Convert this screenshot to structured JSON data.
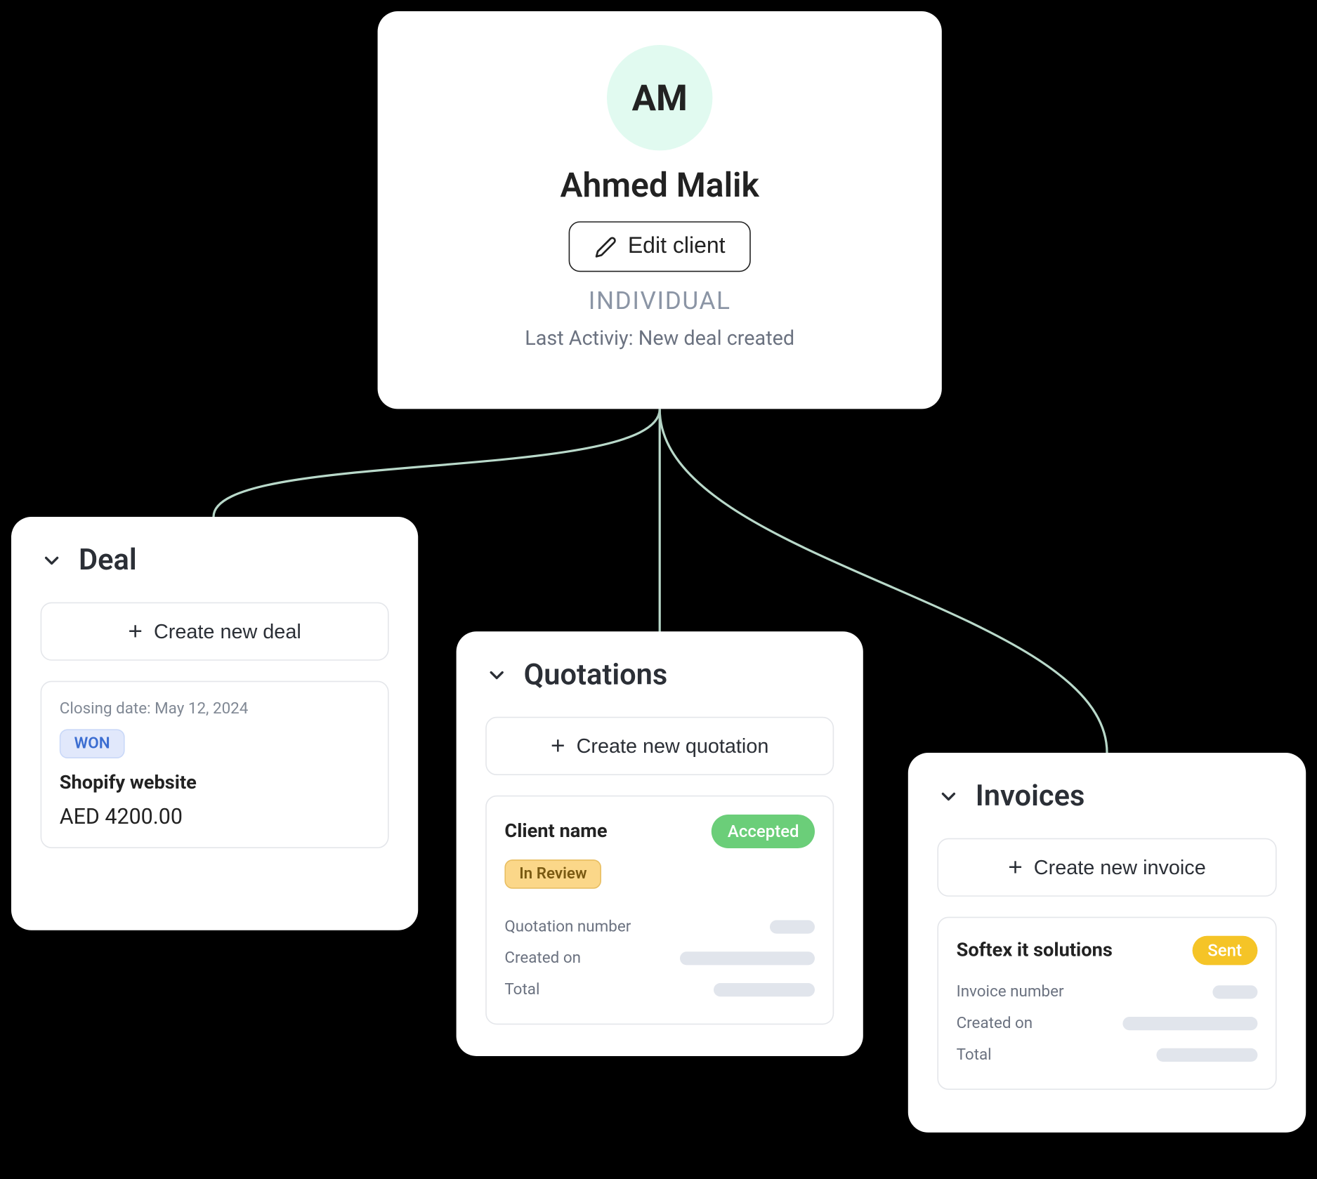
{
  "client": {
    "initials": "AM",
    "name": "Ahmed Malik",
    "edit_label": "Edit client",
    "type": "INDIVIDUAL",
    "last_activity_label": "Last Activiy: New deal created"
  },
  "deal": {
    "title": "Deal",
    "create_label": "Create new deal",
    "closing_label": "Closing date: May 12, 2024",
    "status": "WON",
    "name": "Shopify website",
    "value": "AED 4200.00"
  },
  "quotations": {
    "title": "Quotations",
    "create_label": "Create new quotation",
    "client_name_label": "Client name",
    "accepted_label": "Accepted",
    "in_review_label": "In Review",
    "fields": {
      "quotation_number": "Quotation number",
      "created_on": "Created on",
      "total": "Total"
    }
  },
  "invoices": {
    "title": "Invoices",
    "create_label": "Create new invoice",
    "client_name": "Softex it solutions",
    "sent_label": "Sent",
    "fields": {
      "invoice_number": "Invoice number",
      "created_on": "Created on",
      "total": "Total"
    }
  }
}
